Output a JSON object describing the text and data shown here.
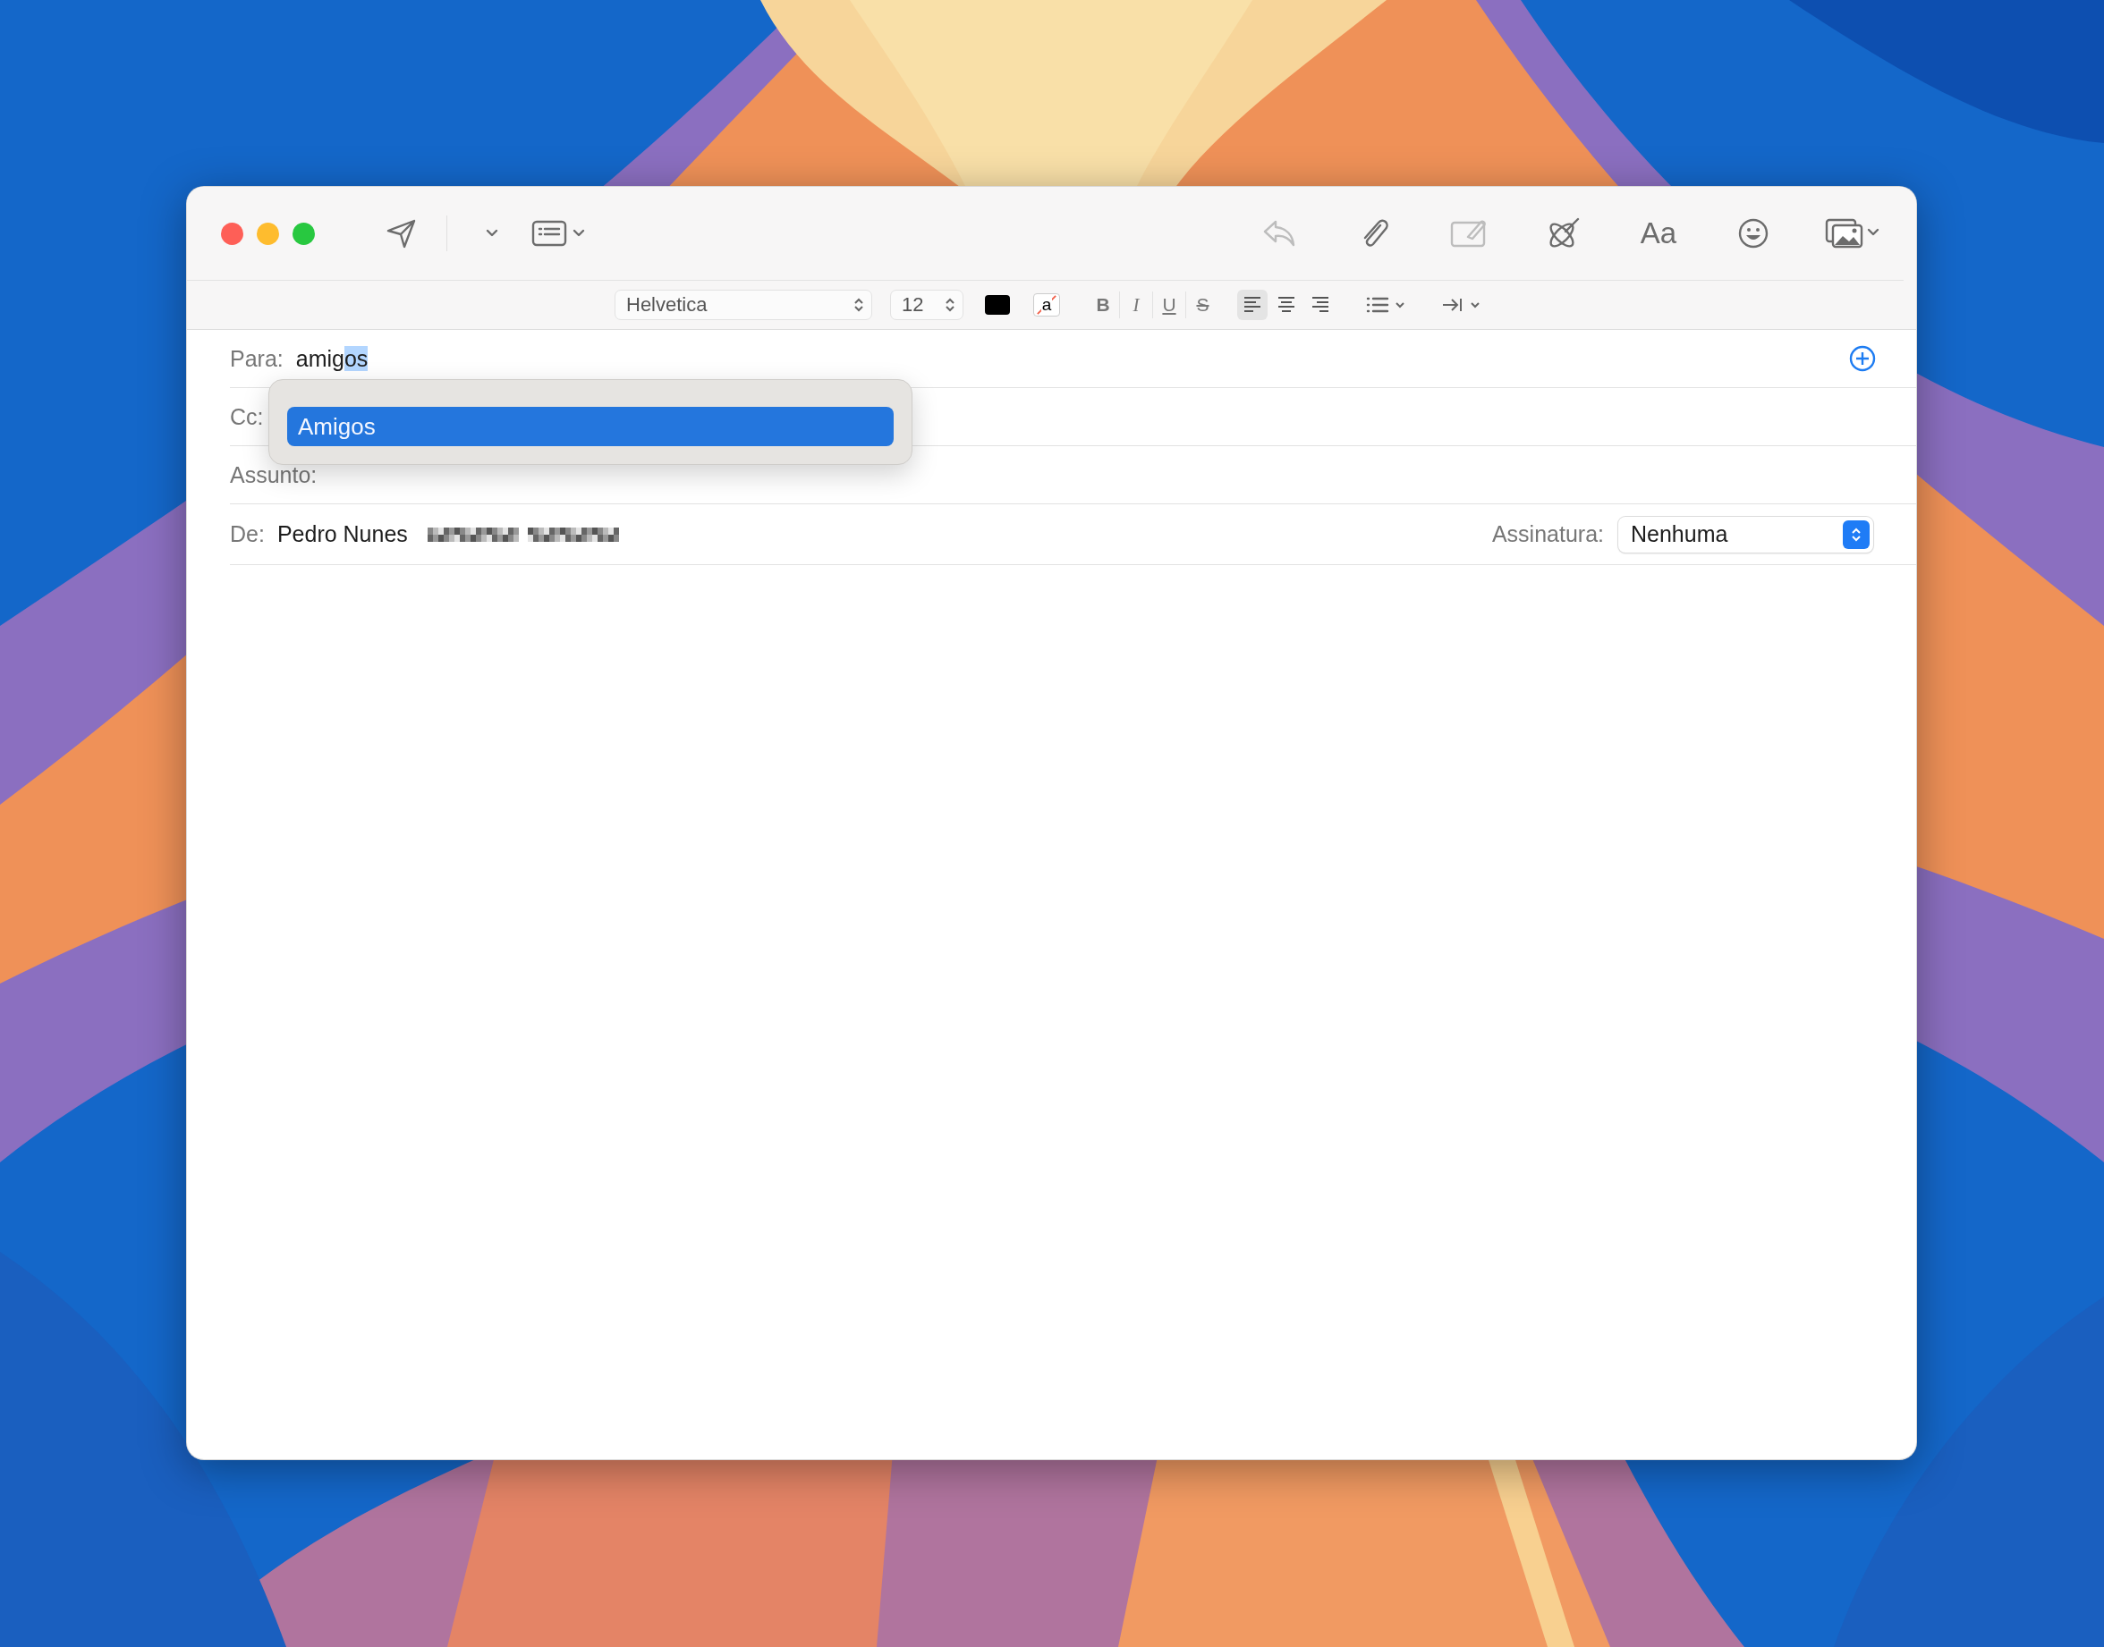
{
  "window": {
    "controls": [
      {
        "kind": "close"
      },
      {
        "kind": "minimize"
      },
      {
        "kind": "zoom"
      }
    ]
  },
  "toolbar": {
    "left": [
      {
        "kind": "send",
        "disabled": false
      },
      {
        "kind": "chevron",
        "disabled": false
      },
      {
        "kind": "headers",
        "disabled": false
      }
    ],
    "right": [
      {
        "kind": "reply",
        "disabled": true
      },
      {
        "kind": "attach",
        "disabled": false
      },
      {
        "kind": "markup",
        "disabled": true
      },
      {
        "kind": "writing",
        "disabled": false
      },
      {
        "kind": "fonts",
        "label": "Aa",
        "disabled": false
      },
      {
        "kind": "emoji",
        "disabled": false
      },
      {
        "kind": "photos",
        "disabled": false
      }
    ]
  },
  "format_bar": {
    "font": "Helvetica",
    "size": "12",
    "highlight": "a",
    "styles": [
      {
        "kind": "bold",
        "label": "B"
      },
      {
        "kind": "italic",
        "label": "I"
      },
      {
        "kind": "underline",
        "label": "U"
      },
      {
        "kind": "strike",
        "label": "S"
      }
    ],
    "alignment": [
      {
        "kind": "left",
        "selected": true
      },
      {
        "kind": "center",
        "selected": false
      },
      {
        "kind": "right",
        "selected": false
      }
    ]
  },
  "header": {
    "to": {
      "label": "Para:",
      "typed": "amig",
      "completion": "os"
    },
    "cc": {
      "label": "Cc:"
    },
    "subject": {
      "label": "Assunto:"
    },
    "from": {
      "label": "De:",
      "value": "Pedro Nunes"
    },
    "signature": {
      "label": "Assinatura:",
      "value": "Nenhuma"
    }
  },
  "autocomplete": {
    "items": [
      {
        "label": "Amigos",
        "selected": true
      }
    ]
  }
}
